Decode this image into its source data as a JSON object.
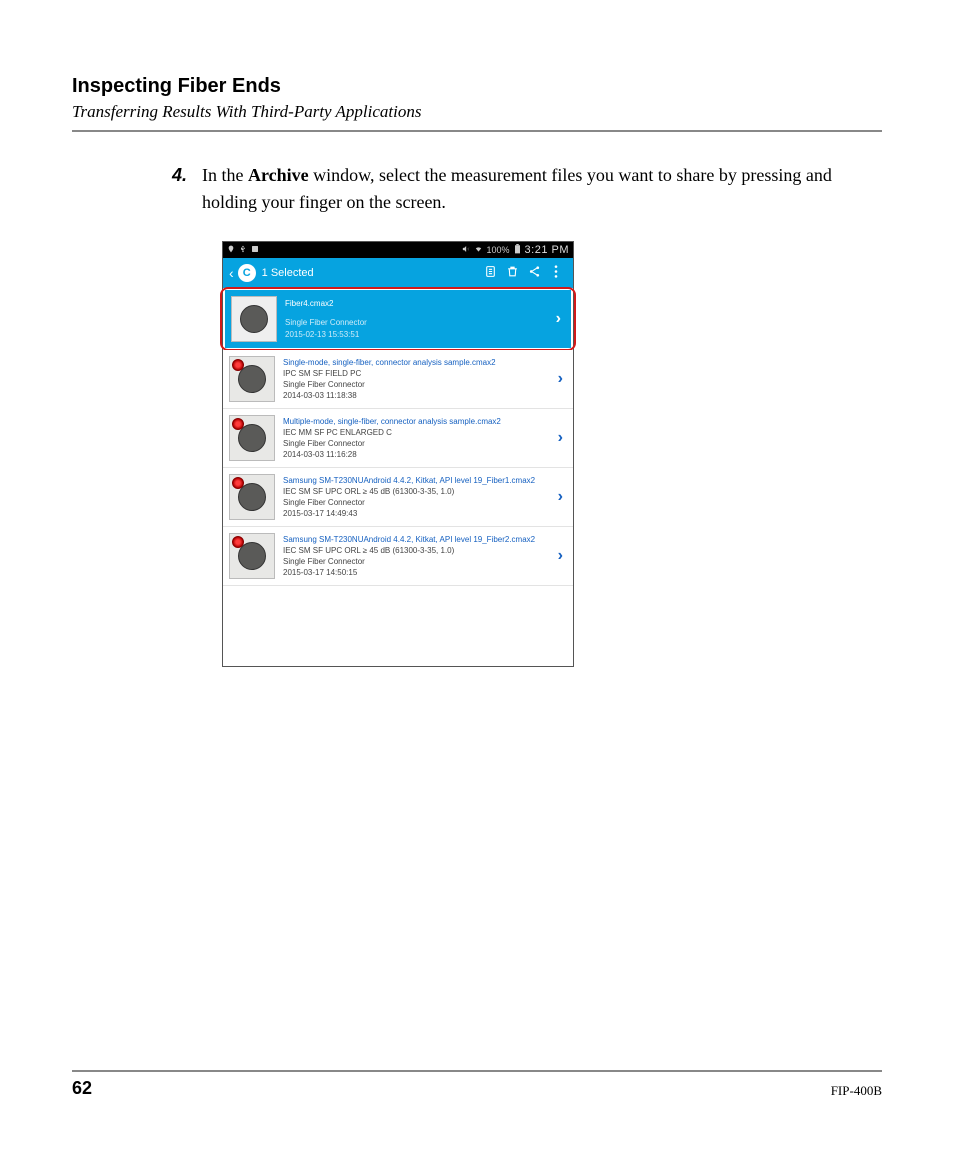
{
  "header": {
    "chapter": "Inspecting Fiber Ends",
    "section": "Transferring Results With Third-Party Applications"
  },
  "step": {
    "number": "4.",
    "text_pre": "In the ",
    "text_bold": "Archive",
    "text_post": " window, select the measurement files you want to share by pressing and holding your finger on the screen."
  },
  "statusbar": {
    "battery": "100%",
    "time": "3:21 PM"
  },
  "appbar": {
    "title": "1 Selected"
  },
  "rows": [
    {
      "filename": "Fiber4.cmax2",
      "standard": "",
      "type": "Single Fiber Connector",
      "date": "2015-02-13 15:53:51",
      "selected": true
    },
    {
      "filename": "Single-mode, single-fiber, connector analysis sample.cmax2",
      "standard": "IPC SM SF FIELD PC",
      "type": "Single Fiber Connector",
      "date": "2014-03-03 11:18:38",
      "selected": false
    },
    {
      "filename": "Multiple-mode, single-fiber, connector analysis sample.cmax2",
      "standard": "IEC MM SF PC ENLARGED C",
      "type": "Single Fiber Connector",
      "date": "2014-03-03 11:16:28",
      "selected": false
    },
    {
      "filename": "Samsung SM-T230NUAndroid 4.4.2, Kitkat, API level 19_Fiber1.cmax2",
      "standard": "IEC SM SF UPC ORL ≥ 45 dB (61300-3-35, 1.0)",
      "type": "Single Fiber Connector",
      "date": "2015-03-17 14:49:43",
      "selected": false
    },
    {
      "filename": "Samsung SM-T230NUAndroid 4.4.2, Kitkat, API level 19_Fiber2.cmax2",
      "standard": "IEC SM SF UPC ORL ≥ 45 dB (61300-3-35, 1.0)",
      "type": "Single Fiber Connector",
      "date": "2015-03-17 14:50:15",
      "selected": false
    }
  ],
  "footer": {
    "page": "62",
    "model": "FIP-400B"
  }
}
